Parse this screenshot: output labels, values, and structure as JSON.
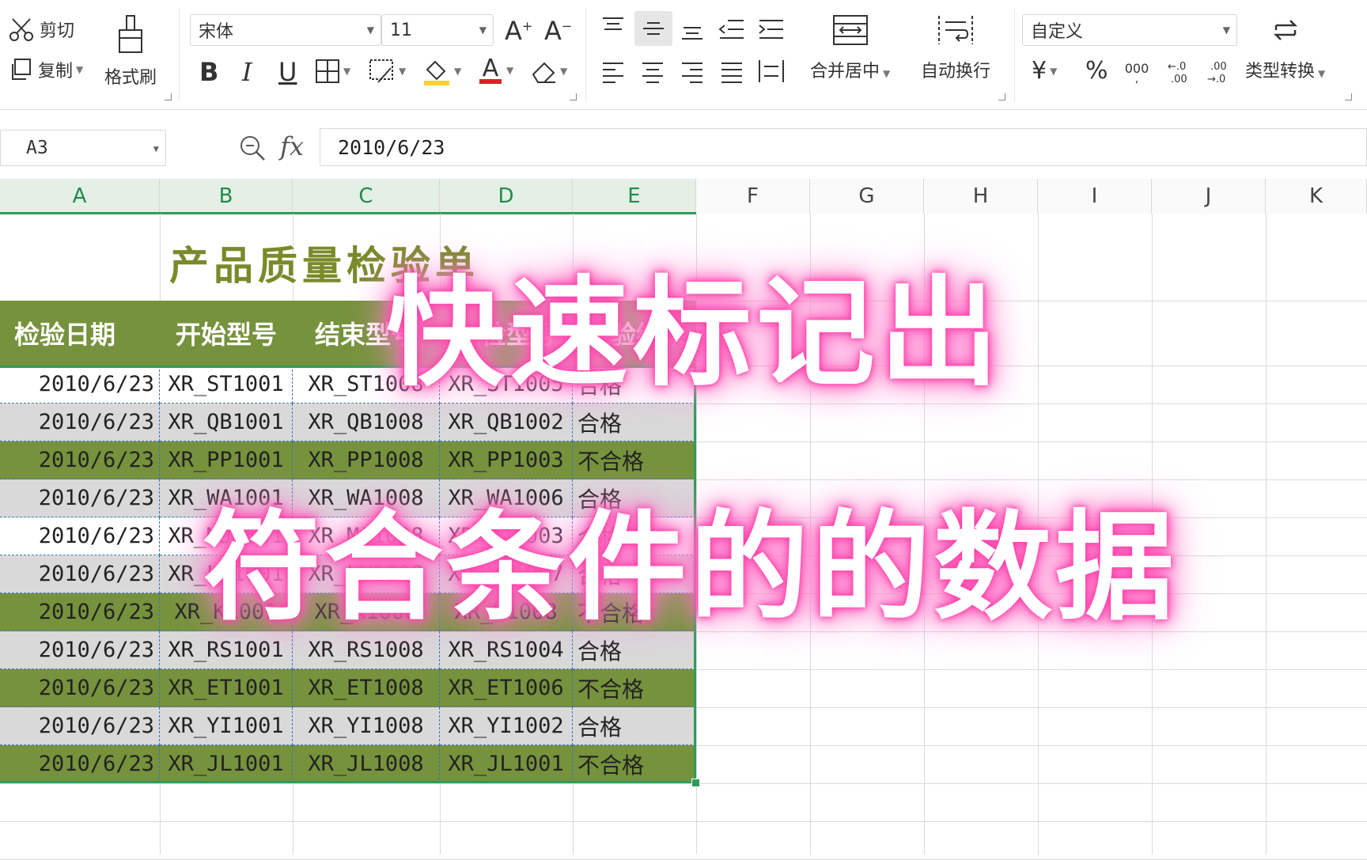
{
  "ribbon": {
    "clipboard": {
      "cut": "剪切",
      "copy": "复制",
      "format_painter": "格式刷"
    },
    "font": {
      "name": "宋体",
      "size": "11"
    },
    "alignment": {
      "merge_center": "合并居中",
      "wrap_text": "自动换行"
    },
    "number": {
      "format": "自定义",
      "currency_symbol": "¥",
      "percent_symbol": "%",
      "type_convert": "类型转换"
    }
  },
  "formula_bar": {
    "name_box": "A3",
    "fx_label": "fx",
    "content": "2010/6/23"
  },
  "columns": [
    "A",
    "B",
    "C",
    "D",
    "E",
    "F",
    "G",
    "H",
    "I",
    "J",
    "K"
  ],
  "sheet": {
    "title": "产品质量检验单",
    "headers": [
      "检验日期",
      "开始型号",
      "结束型号",
      "抽检型号",
      "检验结果"
    ],
    "rows": [
      {
        "date": "2010/6/23",
        "start": "XR_ST1001",
        "end": "XR_ST1008",
        "sample": "XR_ST1005",
        "result": "合格"
      },
      {
        "date": "2010/6/23",
        "start": "XR_QB1001",
        "end": "XR_QB1008",
        "sample": "XR_QB1002",
        "result": "合格"
      },
      {
        "date": "2010/6/23",
        "start": "XR_PP1001",
        "end": "XR_PP1008",
        "sample": "XR_PP1003",
        "result": "不合格"
      },
      {
        "date": "2010/6/23",
        "start": "XR_WA1001",
        "end": "XR_WA1008",
        "sample": "XR_WA1006",
        "result": "合格"
      },
      {
        "date": "2010/6/23",
        "start": "XR_MJ1001",
        "end": "XR_MJ1008",
        "sample": "XR_MJ1003",
        "result": "合格"
      },
      {
        "date": "2010/6/23",
        "start": "XR_LY1001",
        "end": "XR_LY1008",
        "sample": "XR_LY1007",
        "result": "合格"
      },
      {
        "date": "2010/6/23",
        "start": "XR_K1001",
        "end": "XR_K1008",
        "sample": "XR_K1008",
        "result": "不合格"
      },
      {
        "date": "2010/6/23",
        "start": "XR_RS1001",
        "end": "XR_RS1008",
        "sample": "XR_RS1004",
        "result": "合格"
      },
      {
        "date": "2010/6/23",
        "start": "XR_ET1001",
        "end": "XR_ET1008",
        "sample": "XR_ET1006",
        "result": "不合格"
      },
      {
        "date": "2010/6/23",
        "start": "XR_YI1001",
        "end": "XR_YI1008",
        "sample": "XR_YI1002",
        "result": "合格"
      },
      {
        "date": "2010/6/23",
        "start": "XR_JL1001",
        "end": "XR_JL1008",
        "sample": "XR_JL1001",
        "result": "不合格"
      }
    ]
  },
  "overlay": {
    "line1": "快速标记出",
    "line2": "符合条件的的数据"
  },
  "colors": {
    "header_green": "#76923c",
    "row_light": "#d9d9d9",
    "selection": "#2e9c5a",
    "glow": "#ff3fa8",
    "title": "#7a8a2a"
  }
}
